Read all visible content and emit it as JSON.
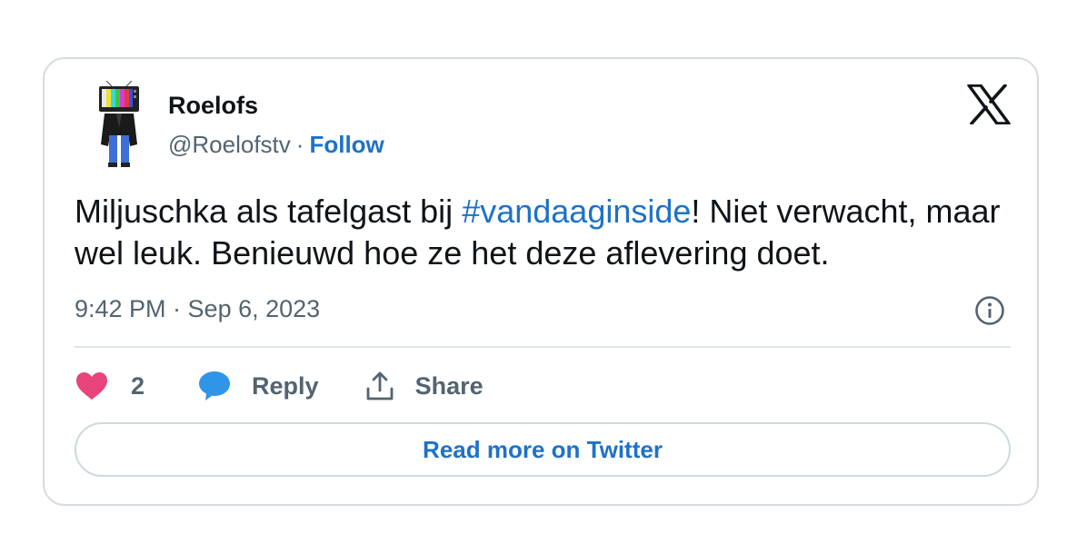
{
  "tweet": {
    "author": {
      "name": "Roelofs",
      "handle": "@Roelofstv",
      "separator": "·",
      "follow_label": "Follow"
    },
    "text": {
      "before": "Miljuschka als tafelgast bij ",
      "hashtag": "#vandaaginside",
      "after": "! Niet verwacht, maar wel leuk. Benieuwd hoe ze het deze aflevering doet."
    },
    "timestamp": "9:42 PM · Sep 6, 2023",
    "actions": {
      "like_count": "2",
      "reply_label": "Reply",
      "share_label": "Share"
    },
    "read_more_label": "Read more on Twitter"
  },
  "colors": {
    "link": "#1d72c9",
    "like_heart": "#e8437a",
    "reply_bubble": "#2f95e8",
    "muted_text": "#536471",
    "border": "#d7dce0"
  },
  "icons": {
    "logo": "x-logo-icon",
    "info": "info-icon",
    "like": "heart-icon",
    "reply": "speech-bubble-icon",
    "share": "share-upload-icon"
  }
}
